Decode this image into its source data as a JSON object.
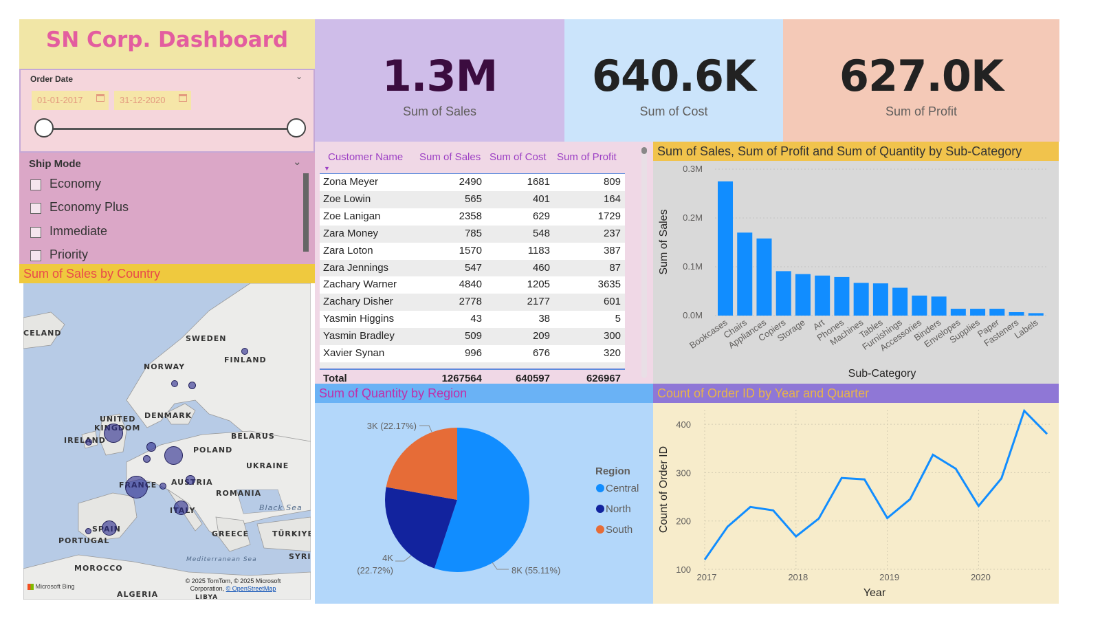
{
  "title": "SN Corp. Dashboard",
  "kpis": {
    "sales": {
      "value": "1.3M",
      "label": "Sum of Sales",
      "color": "#3b0c3f"
    },
    "cost": {
      "value": "640.6K",
      "label": "Sum of Cost",
      "color": "#222222"
    },
    "profit": {
      "value": "627.0K",
      "label": "Sum of Profit",
      "color": "#222222"
    }
  },
  "order_date": {
    "title": "Order Date",
    "start": "01-01-2017",
    "end": "31-12-2020"
  },
  "ship_mode": {
    "title": "Ship Mode",
    "options": [
      "Economy",
      "Economy Plus",
      "Immediate",
      "Priority"
    ]
  },
  "map": {
    "header": "Sum of Sales by Country",
    "labels": {
      "iceland": "CELAND",
      "sweden": "SWEDEN",
      "finland": "FINLAND",
      "norway": "NORWAY",
      "united": "UNITED",
      "kingdom": "KINGDOM",
      "denmark": "DENMARK",
      "ireland": "IRELAND",
      "belarus": "BELARUS",
      "poland": "POLAND",
      "ukraine": "UKRAINE",
      "france": "FRANCE",
      "austria": "AUSTRIA",
      "romania": "ROMANIA",
      "black_sea": "Black Sea",
      "italy": "ITALY",
      "spain": "SPAIN",
      "greece": "GREECE",
      "turkiye": "TÜRKIYE",
      "portugal": "PORTUGAL",
      "med_sea": "Mediterranean Sea",
      "syria": "SYRI",
      "morocco": "MOROCCO",
      "algeria": "ALGERIA",
      "libya": "LIBYA"
    },
    "brand": "Microsoft Bing",
    "copyright": "© 2025 TomTom, © 2025 Microsoft",
    "copyright2": "Corporation, ",
    "osm": "© OpenStreetMap"
  },
  "table": {
    "headers": [
      "Customer Name",
      "Sum of Sales",
      "Sum of Cost",
      "Sum of Profit"
    ],
    "rows": [
      [
        "Zona Meyer",
        "2490",
        "1681",
        "809"
      ],
      [
        "Zoe Lowin",
        "565",
        "401",
        "164"
      ],
      [
        "Zoe Lanigan",
        "2358",
        "629",
        "1729"
      ],
      [
        "Zara Money",
        "785",
        "548",
        "237"
      ],
      [
        "Zara Loton",
        "1570",
        "1183",
        "387"
      ],
      [
        "Zara Jennings",
        "547",
        "460",
        "87"
      ],
      [
        "Zachary Warner",
        "4840",
        "1205",
        "3635"
      ],
      [
        "Zachary Disher",
        "2778",
        "2177",
        "601"
      ],
      [
        "Yasmin Higgins",
        "43",
        "38",
        "5"
      ],
      [
        "Yasmin Bradley",
        "509",
        "209",
        "300"
      ],
      [
        "Xavier Synan",
        "996",
        "676",
        "320"
      ]
    ],
    "total": [
      "Total",
      "1267564",
      "640597",
      "626967"
    ]
  },
  "bar_header": "Sum of Sales, Sum of Profit and Sum of Quantity by Sub-Category",
  "pie_header": "Sum of Quantity by Region",
  "line_header": "Count of Order ID by Year and Quarter",
  "colors": {
    "bar": "#118dff",
    "line": "#118dff",
    "central": "#118dff",
    "north": "#12239e",
    "south": "#e66c37"
  },
  "chart_data": [
    {
      "type": "bar",
      "title": "",
      "xlabel": "Sub-Category",
      "ylabel": "Sum of Sales",
      "ylim": [
        0,
        0.3
      ],
      "yticks": [
        "0.0M",
        "0.1M",
        "0.2M",
        "0.3M"
      ],
      "categories": [
        "Bookcases",
        "Chairs",
        "Appliances",
        "Copiers",
        "Storage",
        "Art",
        "Phones",
        "Machines",
        "Tables",
        "Furnishings",
        "Accessories",
        "Binders",
        "Envelopes",
        "Supplies",
        "Paper",
        "Fasteners",
        "Labels"
      ],
      "values": [
        0.275,
        0.17,
        0.158,
        0.091,
        0.085,
        0.082,
        0.079,
        0.067,
        0.066,
        0.057,
        0.041,
        0.039,
        0.014,
        0.014,
        0.014,
        0.007,
        0.005
      ],
      "grid": true
    },
    {
      "type": "pie",
      "legend_title": "Region",
      "slices": [
        {
          "name": "Central",
          "value": 8000,
          "label": "8K (55.11%)"
        },
        {
          "name": "North",
          "value": 4000,
          "label": "4K",
          "label2": "(22.72%)"
        },
        {
          "name": "South",
          "value": 3000,
          "label": "3K (22.17%)"
        }
      ],
      "percents": [
        55.11,
        22.72,
        22.17
      ]
    },
    {
      "type": "line",
      "xlabel": "Year",
      "ylabel": "Count of Order ID",
      "ylim": [
        100,
        430
      ],
      "yticks": [
        "100",
        "200",
        "300",
        "400"
      ],
      "xticks": [
        "2017",
        "2018",
        "2019",
        "2020"
      ],
      "x": [
        "2017 Q1",
        "2017 Q2",
        "2017 Q3",
        "2017 Q4",
        "2018 Q1",
        "2018 Q2",
        "2018 Q3",
        "2018 Q4",
        "2019 Q1",
        "2019 Q2",
        "2019 Q3",
        "2019 Q4",
        "2020 Q1",
        "2020 Q2",
        "2020 Q3",
        "2020 Q4"
      ],
      "values": [
        120,
        188,
        229,
        222,
        168,
        205,
        289,
        286,
        206,
        245,
        337,
        308,
        231,
        288,
        428,
        380
      ],
      "grid": true
    }
  ]
}
